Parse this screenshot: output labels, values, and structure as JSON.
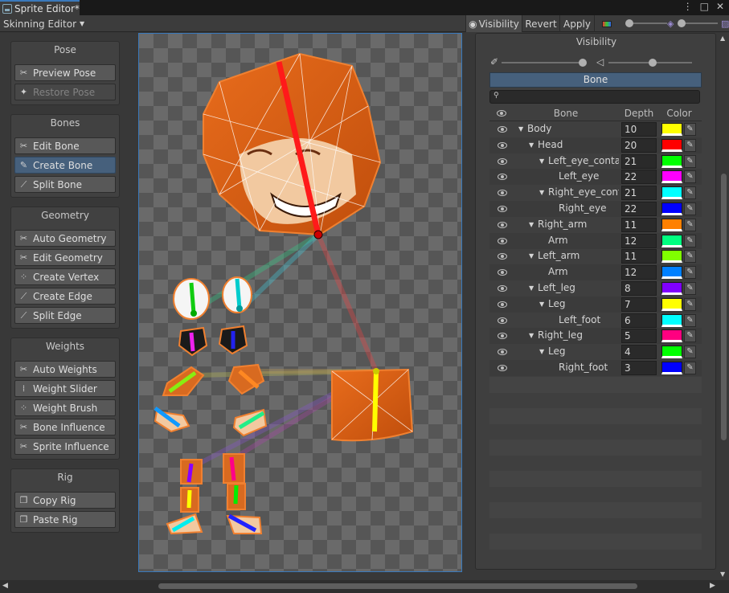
{
  "window": {
    "tab_title": "Sprite Editor*",
    "buttons": [
      "⋮",
      "□",
      "✕"
    ]
  },
  "toolbar": {
    "mode": "Skinning Editor",
    "visibility": "Visibility",
    "revert": "Revert",
    "apply": "Apply"
  },
  "tools": {
    "pose": {
      "title": "Pose",
      "items": [
        "Preview Pose",
        "Restore Pose"
      ]
    },
    "bones": {
      "title": "Bones",
      "items": [
        "Edit Bone",
        "Create Bone",
        "Split Bone"
      ]
    },
    "geometry": {
      "title": "Geometry",
      "items": [
        "Auto Geometry",
        "Edit Geometry",
        "Create Vertex",
        "Create Edge",
        "Split Edge"
      ]
    },
    "weights": {
      "title": "Weights",
      "items": [
        "Auto Weights",
        "Weight Slider",
        "Weight Brush",
        "Bone Influence",
        "Sprite Influence"
      ]
    },
    "rig": {
      "title": "Rig",
      "items": [
        "Copy Rig",
        "Paste Rig"
      ]
    }
  },
  "visibility_panel": {
    "title": "Visibility",
    "tab": "Bone",
    "columns": {
      "bone": "Bone",
      "depth": "Depth",
      "color": "Color"
    },
    "bones": [
      {
        "name": "Body",
        "depth": "10",
        "color": "#ffff00"
      },
      {
        "name": "Head",
        "depth": "20",
        "color": "#ff0000"
      },
      {
        "name": "Left_eye_conta",
        "depth": "21",
        "color": "#00ff00"
      },
      {
        "name": "Left_eye",
        "depth": "22",
        "color": "#ff00ff"
      },
      {
        "name": "Right_eye_cont",
        "depth": "21",
        "color": "#00ffff"
      },
      {
        "name": "Right_eye",
        "depth": "22",
        "color": "#0000ff"
      },
      {
        "name": "Right_arm",
        "depth": "11",
        "color": "#ff8000"
      },
      {
        "name": "Arm",
        "depth": "12",
        "color": "#00ff80"
      },
      {
        "name": "Left_arm",
        "depth": "11",
        "color": "#80ff00"
      },
      {
        "name": "Arm",
        "depth": "12",
        "color": "#0080ff"
      },
      {
        "name": "Left_leg",
        "depth": "8",
        "color": "#8000ff"
      },
      {
        "name": "Leg",
        "depth": "7",
        "color": "#ffff00"
      },
      {
        "name": "Left_foot",
        "depth": "6",
        "color": "#00ffff"
      },
      {
        "name": "Right_leg",
        "depth": "5",
        "color": "#ff0080"
      },
      {
        "name": "Leg",
        "depth": "4",
        "color": "#00ff00"
      },
      {
        "name": "Right_foot",
        "depth": "3",
        "color": "#0000ff"
      }
    ]
  }
}
